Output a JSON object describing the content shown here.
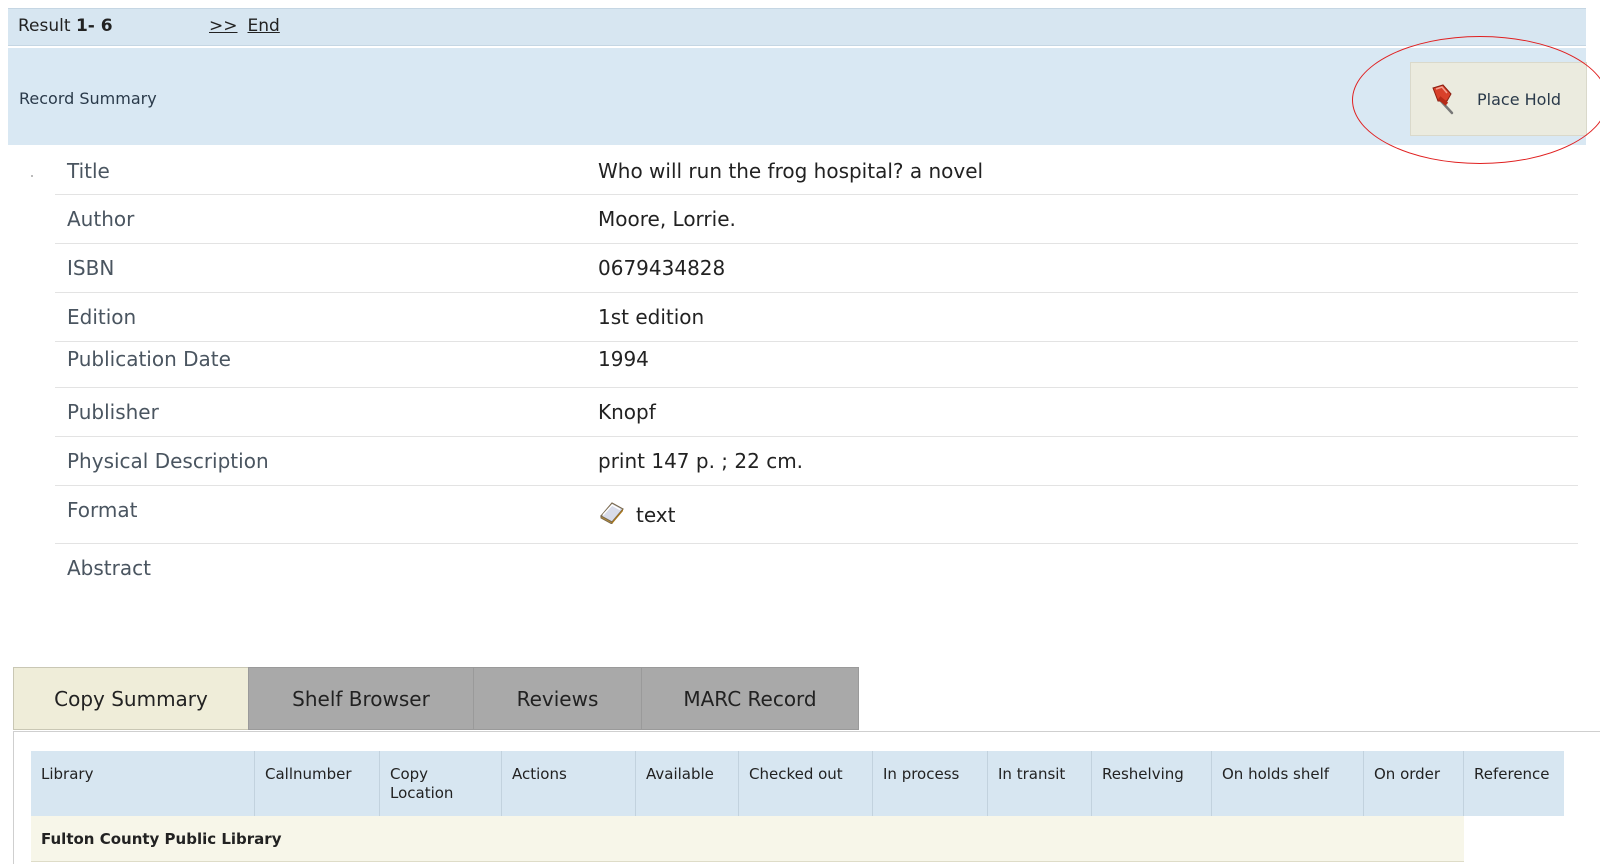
{
  "result_bar": {
    "result_label": "Result",
    "result_range": "1- 6",
    "next_link": ">>",
    "end_link": "End"
  },
  "record_summary": {
    "label": "Record Summary",
    "place_hold_label": "Place Hold"
  },
  "details": [
    {
      "key": "Title",
      "value": "Who will run the frog hospital? a novel"
    },
    {
      "key": "Author",
      "value": "Moore, Lorrie."
    },
    {
      "key": "ISBN",
      "value": "0679434828"
    },
    {
      "key": "Edition",
      "value": "1st edition"
    },
    {
      "key": "Publication Date",
      "value": "1994"
    },
    {
      "key": "Publisher",
      "value": "Knopf"
    },
    {
      "key": "Physical Description",
      "value": "print 147 p. ; 22 cm."
    },
    {
      "key": "Format",
      "value": "text",
      "icon": "book-icon"
    },
    {
      "key": "Abstract",
      "value": ""
    }
  ],
  "tabs": [
    {
      "label": "Copy Summary",
      "active": true
    },
    {
      "label": "Shelf Browser",
      "active": false
    },
    {
      "label": "Reviews",
      "active": false
    },
    {
      "label": "MARC Record",
      "active": false
    }
  ],
  "copy_table": {
    "columns": [
      "Library",
      "Callnumber",
      "Copy\nLocation",
      "Actions",
      "Available",
      "Checked out",
      "In process",
      "In transit",
      "Reshelving",
      "On holds shelf",
      "On order",
      "Reference"
    ],
    "library_row": "Fulton County Public Library"
  },
  "colors": {
    "bar_bg": "#d7e6f1",
    "hold_button_bg": "#ebebdf",
    "annotation_circle": "#e02020",
    "active_tab_bg": "#efedd9",
    "inactive_tab_bg": "#a9a9a9"
  }
}
